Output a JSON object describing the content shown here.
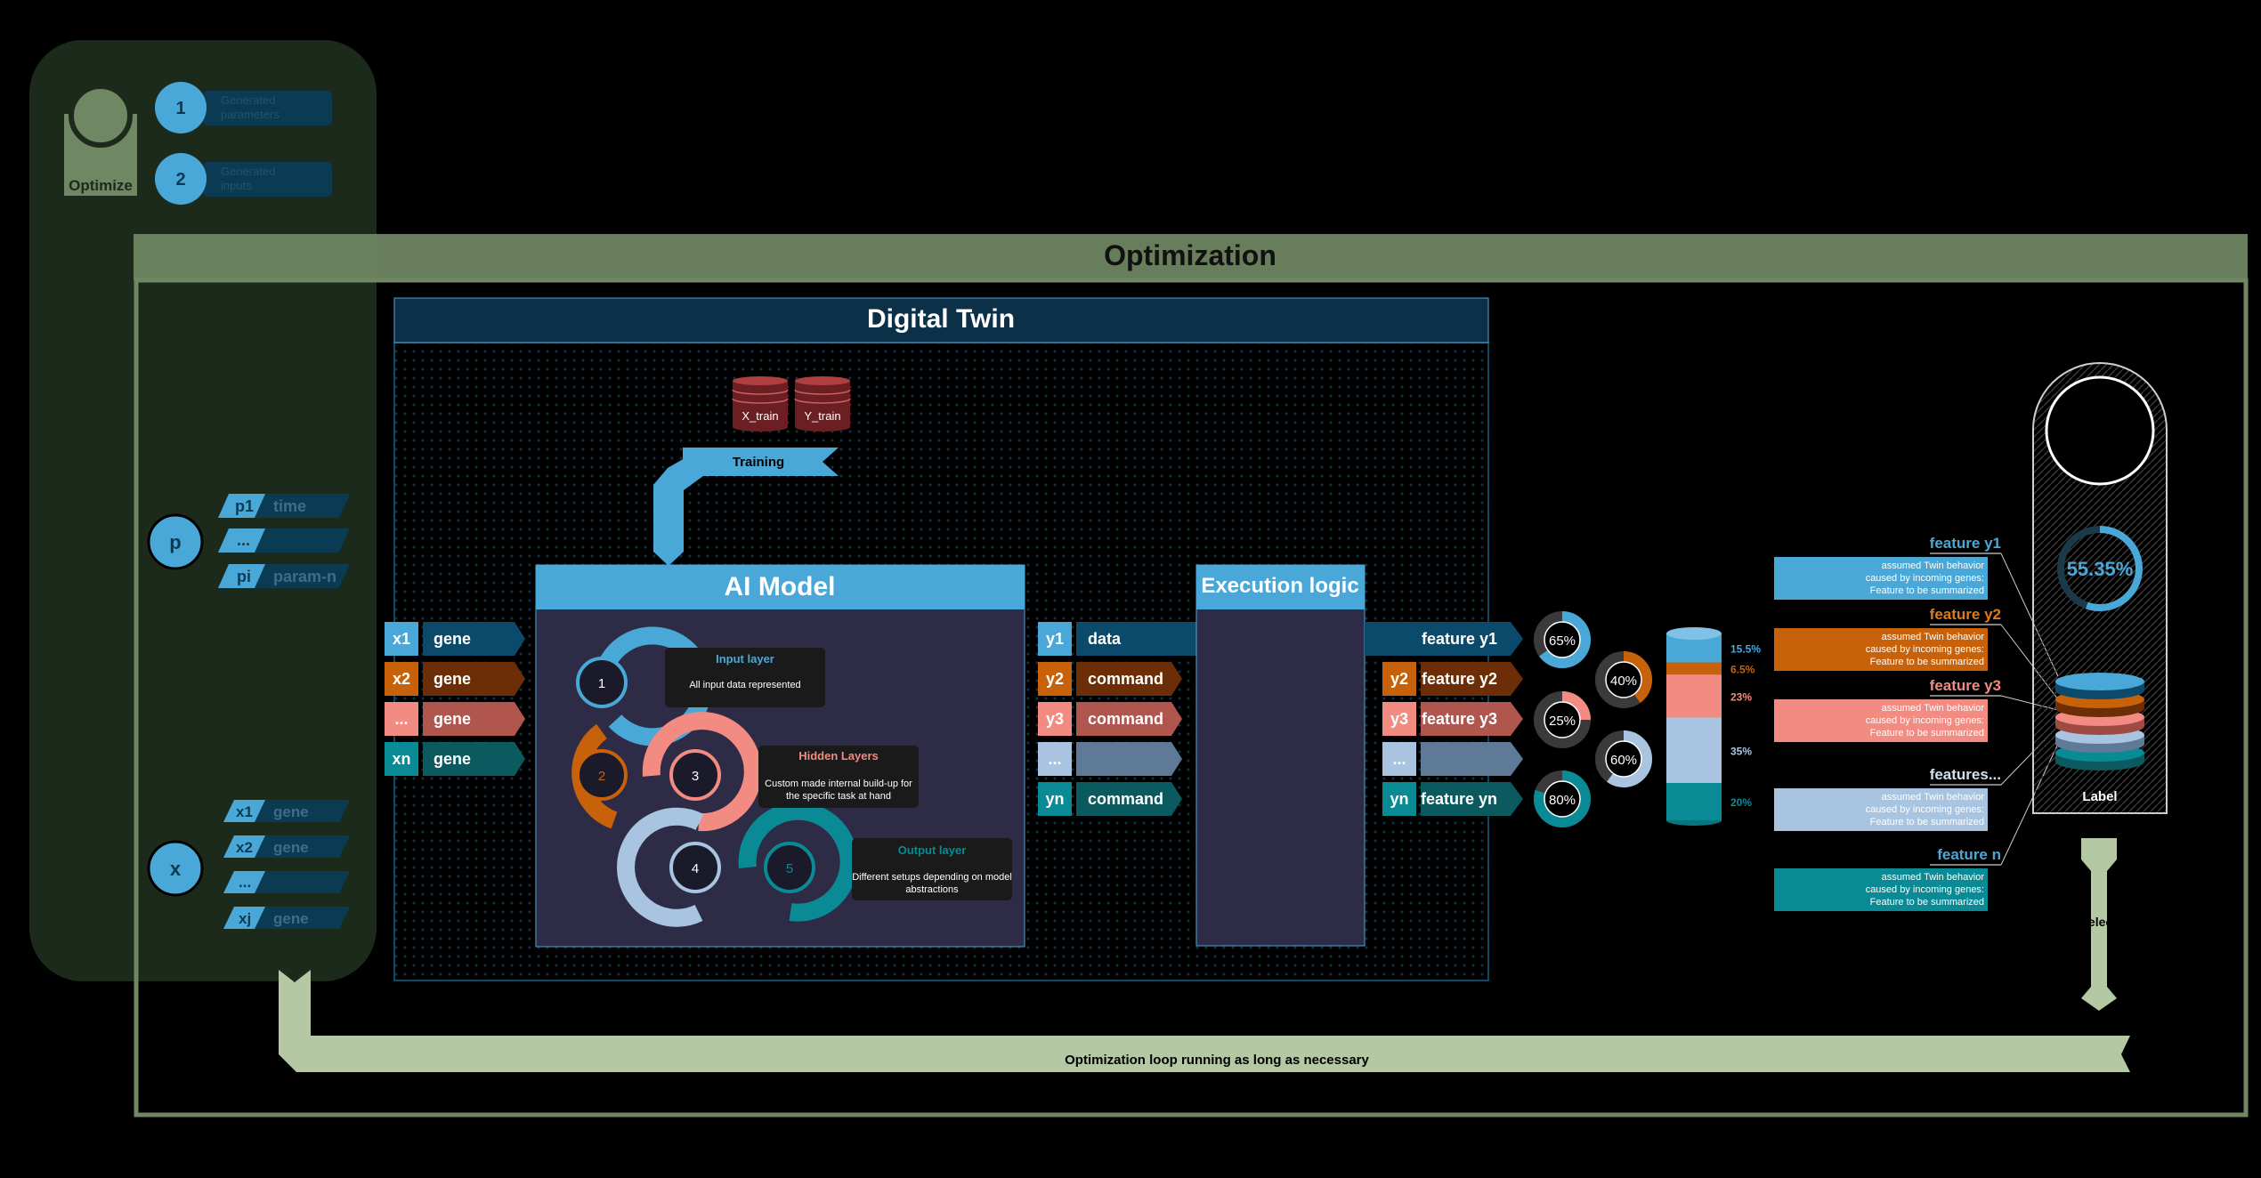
{
  "optimize_panel": {
    "label": "Optimize",
    "steps": [
      {
        "num": "1",
        "text_line1": "Generated",
        "text_line2": "parameters"
      },
      {
        "num": "2",
        "text_line1": "Generated",
        "text_line2": "inputs"
      }
    ]
  },
  "optimization": {
    "title": "Optimization",
    "loop_label": "Optimization loop running as long as necessary",
    "select_label": "select"
  },
  "params": {
    "circle": "p",
    "items": [
      {
        "tag": "p1",
        "text": "time"
      },
      {
        "tag": "...",
        "text": ""
      },
      {
        "tag": "pi",
        "text": "param-n"
      }
    ]
  },
  "inputs_x": {
    "circle": "x",
    "items": [
      {
        "tag": "x1",
        "text": "gene"
      },
      {
        "tag": "x2",
        "text": "gene"
      },
      {
        "tag": "...",
        "text": ""
      },
      {
        "tag": "xj",
        "text": "gene"
      }
    ]
  },
  "digital_twin": {
    "title": "Digital Twin",
    "db_labels": [
      "X_train",
      "Y_train"
    ],
    "training_label": "Training",
    "model_inputs": [
      {
        "tag": "x1",
        "text": "gene"
      },
      {
        "tag": "x2",
        "text": "gene"
      },
      {
        "tag": "...",
        "text": "gene"
      },
      {
        "tag": "xn",
        "text": "gene"
      }
    ],
    "ai_model": {
      "title": "AI Model",
      "nodes": [
        "1",
        "2",
        "3",
        "4",
        "5"
      ],
      "input_layer": {
        "title": "Input layer",
        "desc": "All input data represented"
      },
      "hidden_layers": {
        "title": "Hidden Layers",
        "desc_line1": "Custom made internal build-up for",
        "desc_line2": "the specific task at hand"
      },
      "output_layer": {
        "title": "Output layer",
        "desc_line1": "Different setups depending on model",
        "desc_line2": "abstractions"
      }
    },
    "model_outputs": [
      {
        "tag": "y1",
        "text": "data"
      },
      {
        "tag": "y2",
        "text": "command"
      },
      {
        "tag": "y3",
        "text": "command"
      },
      {
        "tag": "...",
        "text": ""
      },
      {
        "tag": "yn",
        "text": "command"
      }
    ],
    "execution_logic": {
      "title": "Execution logic"
    },
    "features": [
      {
        "tag": "",
        "text": "feature y1"
      },
      {
        "tag": "y2",
        "text": "feature y2"
      },
      {
        "tag": "y3",
        "text": "feature y3"
      },
      {
        "tag": "...",
        "text": ""
      },
      {
        "tag": "yn",
        "text": "feature yn"
      }
    ]
  },
  "rings": [
    {
      "label": "65%",
      "value": 65,
      "color": "#4aa8d8"
    },
    {
      "label": "40%",
      "value": 40,
      "color": "#c8620a"
    },
    {
      "label": "25%",
      "value": 25,
      "color": "#f28b82"
    },
    {
      "label": "60%",
      "value": 60,
      "color": "#a8c4e0"
    },
    {
      "label": "80%",
      "value": 80,
      "color": "#0a8a94"
    }
  ],
  "stack": {
    "segments": [
      {
        "label": "15.5%",
        "value": 15.5,
        "color": "#4aa8d8"
      },
      {
        "label": "6.5%",
        "value": 6.5,
        "color": "#c8620a"
      },
      {
        "label": "23%",
        "value": 23,
        "color": "#f28b82"
      },
      {
        "label": "35%",
        "value": 35,
        "color": "#a8c4e0"
      },
      {
        "label": "20%",
        "value": 20,
        "color": "#0a8a94"
      }
    ]
  },
  "feature_cards": [
    {
      "title": "feature y1",
      "color": "#4aa8d8",
      "title_color": "#4aa8d8",
      "desc": [
        "assumed Twin behavior",
        "caused by incoming genes:",
        "Feature to be summarized"
      ]
    },
    {
      "title": "feature y2",
      "color": "#c8620a",
      "title_color": "#e07a1a",
      "desc": [
        "assumed Twin behavior",
        "caused by incoming genes:",
        "Feature to be summarized"
      ]
    },
    {
      "title": "feature y3",
      "color": "#f28b82",
      "title_color": "#f28b82",
      "desc": [
        "assumed Twin behavior",
        "caused by incoming genes:",
        "Feature to be summarized"
      ]
    },
    {
      "title": "features...",
      "color": "#a8c4e0",
      "title_color": "#cfe0ef",
      "desc": [
        "assumed Twin behavior",
        "caused by incoming genes:",
        "Feature to be summarized"
      ]
    },
    {
      "title": "feature n",
      "color": "#0a8a94",
      "title_color": "#4aa8d8",
      "desc": [
        "assumed Twin behavior",
        "caused by incoming genes:",
        "Feature to be summarized"
      ]
    }
  ],
  "tag_panel": {
    "gauge_label": "55.35%",
    "gauge_value": 55.35,
    "label": "Label"
  },
  "colors": {
    "blue": "#4aa8d8",
    "orange": "#c8620a",
    "salmon": "#f28b82",
    "lightblue": "#a8c4e0",
    "teal": "#0a8a94",
    "green_frame": "#6f8762",
    "green_light": "#b4c8a4"
  }
}
